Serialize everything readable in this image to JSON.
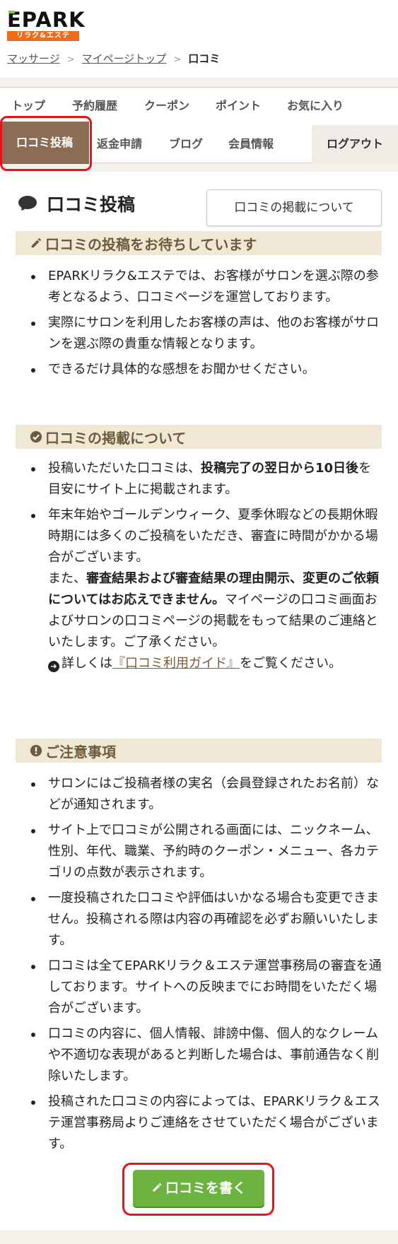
{
  "header": {
    "logo_main": "EPARK",
    "logo_sub": "リラク&エステ"
  },
  "breadcrumb": {
    "items": [
      "マッサージ",
      "マイページトップ"
    ],
    "separator": ">",
    "current": "口コミ"
  },
  "nav": {
    "row1": [
      "トップ",
      "予約履歴",
      "クーポン",
      "ポイント",
      "お気に入り"
    ],
    "active": "口コミ投稿",
    "row2": [
      "返金申請",
      "ブログ",
      "会員情報"
    ],
    "logout": "ログアウト"
  },
  "page": {
    "title": "口コミ投稿",
    "about_button": "口コミの掲載について"
  },
  "section1": {
    "heading": "口コミの投稿をお待ちしています",
    "items": [
      "EPARKリラク&エステでは、お客様がサロンを選ぶ際の参考となるよう、口コミページを運営しております。",
      "実際にサロンを利用したお客様の声は、他のお客様がサロンを選ぶ際の貴重な情報となります。",
      "できるだけ具体的な感想をお聞かせください。"
    ]
  },
  "section2": {
    "heading": "口コミの掲載について",
    "item1_pre": "投稿いただいた口コミは、",
    "item1_bold": "投稿完了の翌日から10日後",
    "item1_post": "を目安にサイト上に掲載されます。",
    "item2_p1": "年末年始やゴールデンウィーク、夏季休暇などの長期休暇時期には多くのご投稿をいただき、審査に時間がかかる場合がございます。",
    "item2_p2_pre": "また、",
    "item2_p2_bold": "審査結果および審査結果の理由開示、変更のご依頼についてはお応えできません。",
    "item2_p2_post": "マイページの口コミ画面およびサロンの口コミページの掲載をもって結果のご連絡といたします。ご了承ください。",
    "guide_pre": "詳しくは",
    "guide_link": "『口コミ利用ガイド』",
    "guide_post": "をご覧ください。"
  },
  "section3": {
    "heading": "ご注意事項",
    "items": [
      "サロンにはご投稿者様の実名（会員登録されたお名前）などが通知されます。",
      "サイト上で口コミが公開される画面には、ニックネーム、性別、年代、職業、予約時のクーポン・メニュー、各カテゴリの点数が表示されます。",
      "一度投稿された口コミや評価はいかなる場合も変更できません。投稿される際は内容の再確認を必ずお願いいたします。",
      "口コミは全てEPARKリラク＆エステ運営事務局の審査を通しております。サイトへの反映までにお時間をいただく場合がございます。",
      "口コミの内容に、個人情報、誹謗中傷、個人的なクレームや不適切な表現があると判断した場合は、事前通告なく削除いたします。",
      "投稿された口コミの内容によっては、EPARKリラク＆エステ運営事務局よりご連絡をさせていただく場合がございます。"
    ]
  },
  "write_button": "口コミを書く",
  "colors": {
    "accent_brown": "#8a6d54",
    "section_bg": "#efe8d4",
    "section_text": "#6e5b3e",
    "button_green": "#6db33f",
    "highlight_red": "#e8121b",
    "logo_orange": "#ee6d1c"
  }
}
